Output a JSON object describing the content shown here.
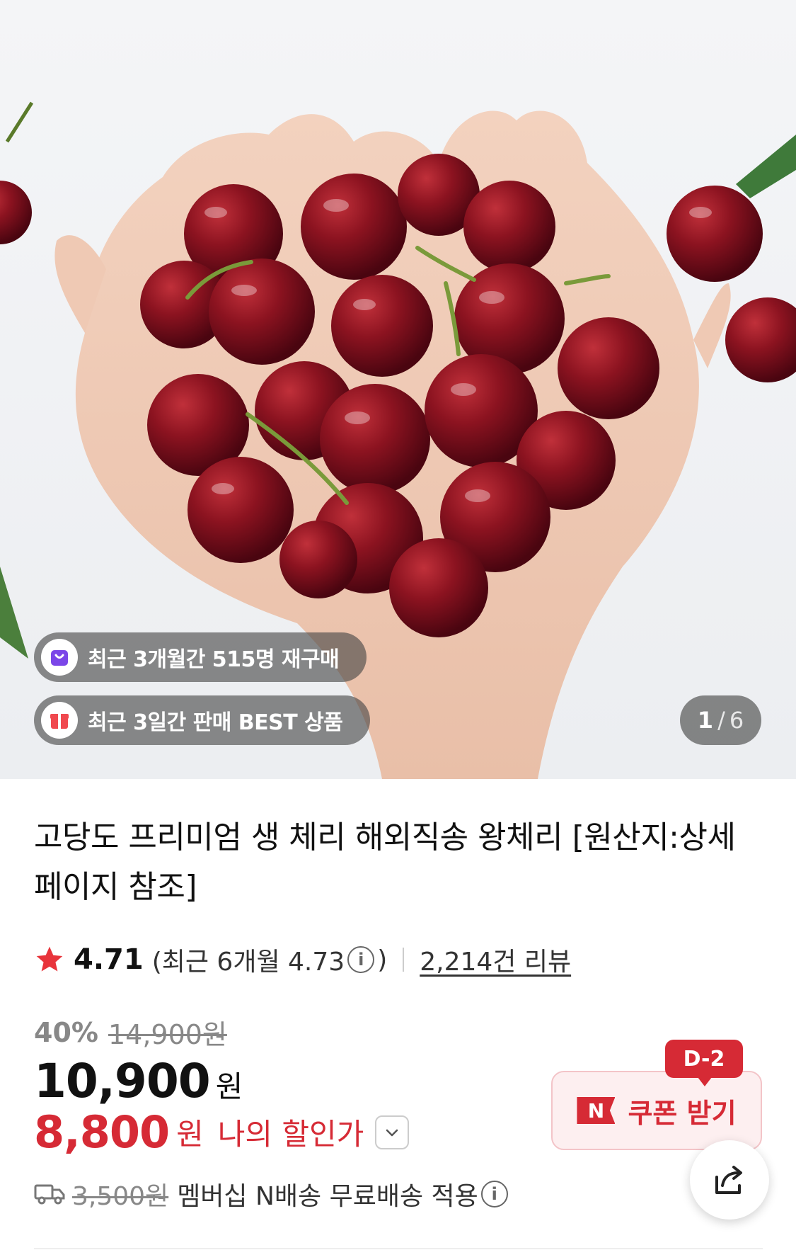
{
  "hero": {
    "badges": [
      {
        "icon": "shopping-bag-icon",
        "text": "최근 3개월간 515명 재구매"
      },
      {
        "icon": "gift-box-icon",
        "text": "최근 3일간 판매 BEST 상품"
      }
    ],
    "counter": {
      "current": "1",
      "separator": "/",
      "total": "6"
    }
  },
  "product": {
    "title": "고당도 프리미엄 생 체리 해외직송 왕체리 [원산지:상세페이지 참조]",
    "rating": {
      "value": "4.71",
      "recent_prefix": "(최근 6개월 4.73",
      "recent_suffix": ")",
      "reviews": "2,214건 리뷰"
    },
    "discount_rate": "40%",
    "original_price": "14,900원",
    "price": "10,900",
    "price_unit": "원",
    "my_price": "8,800",
    "my_price_unit": "원",
    "my_price_label": "나의 할인가"
  },
  "coupon": {
    "badge": "N",
    "label": "쿠폰 받기",
    "dday": "D-2"
  },
  "shipping": {
    "old_fee": "3,500원",
    "text": "멤버십 N배송 무료배송 적용"
  },
  "colors": {
    "accent": "#d62a35",
    "star": "#e8343b"
  }
}
